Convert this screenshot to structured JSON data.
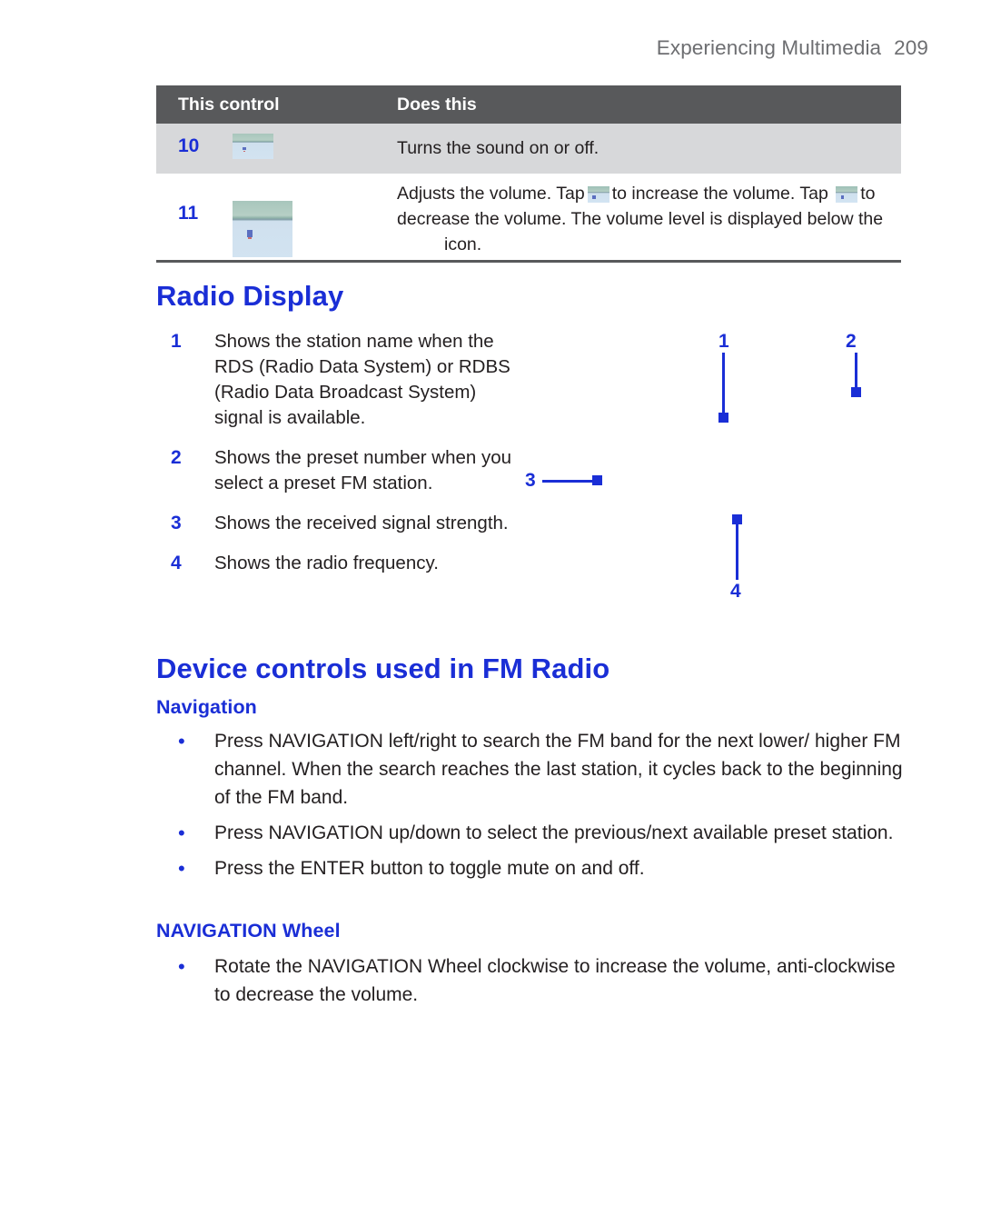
{
  "header": {
    "chapter": "Experiencing Multimedia",
    "page_number": "209"
  },
  "control_table": {
    "columns": {
      "control": "This control",
      "does": "Does this"
    },
    "rows": [
      {
        "number": "10",
        "icon": "mute-button-screenshot",
        "description": "Turns the sound on or off."
      },
      {
        "number": "11",
        "icon": "volume-slider-screenshot",
        "description_part1": "Adjusts the volume. Tap",
        "inline_icon_1": "volume-up-icon",
        "description_part2": "to increase the volume. Tap",
        "inline_icon_2": "volume-down-icon",
        "description_part3": "to decrease the volume. The volume level is displayed below the",
        "inline_icon_3": "speaker-icon",
        "description_part4": "icon."
      }
    ]
  },
  "radio_display": {
    "title": "Radio Display",
    "items": [
      {
        "number": "1",
        "text": "Shows the station name when the RDS (Radio Data System) or RDBS (Radio Data Broadcast System) signal is available."
      },
      {
        "number": "2",
        "text": "Shows the preset number when you select a preset FM station."
      },
      {
        "number": "3",
        "text": "Shows the received signal strength."
      },
      {
        "number": "4",
        "text": "Shows the radio frequency."
      }
    ],
    "callouts": [
      {
        "label": "1"
      },
      {
        "label": "2"
      },
      {
        "label": "3"
      },
      {
        "label": "4"
      }
    ]
  },
  "device_controls": {
    "title": "Device controls used in FM Radio",
    "subsections": [
      {
        "heading": "Navigation",
        "bullets": [
          "Press NAVIGATION left/right to search the FM band for the next lower/ higher FM channel. When the search reaches the last station, it cycles back to the beginning of the FM band.",
          "Press NAVIGATION up/down to select the previous/next available preset station.",
          "Press the ENTER button to toggle mute on and off."
        ]
      },
      {
        "heading": "NAVIGATION Wheel",
        "bullets": [
          "Rotate the NAVIGATION Wheel clockwise to increase the volume, anti-clockwise to decrease the volume."
        ]
      }
    ]
  },
  "colors": {
    "accent_blue": "#1a2ed6",
    "table_header_bg": "#58595b",
    "table_row_bg": "#d7d8da",
    "header_gray": "#6d6e71",
    "body_text": "#231f20"
  },
  "bullet_glyph": "•"
}
